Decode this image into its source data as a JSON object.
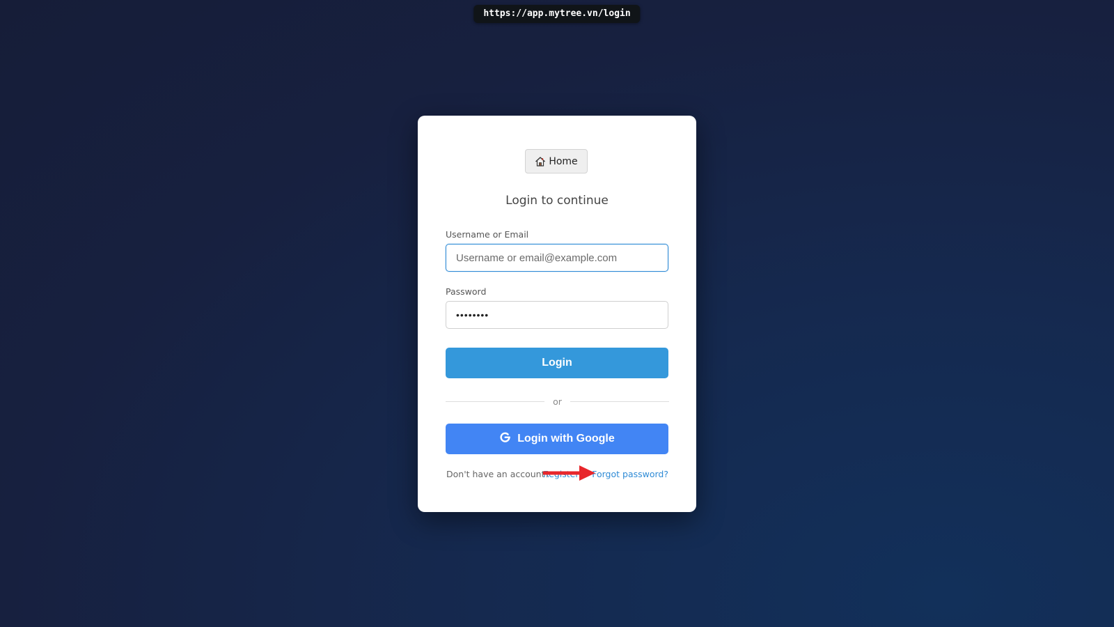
{
  "browser": {
    "url": "https://app.mytree.vn/login"
  },
  "home_button": {
    "label": "Home",
    "icon": "home-icon"
  },
  "form": {
    "title": "Login to continue",
    "username": {
      "label": "Username or Email",
      "placeholder": "Username or email@example.com",
      "value": ""
    },
    "password": {
      "label": "Password",
      "value": "••••••••"
    },
    "login_button": "Login",
    "divider_text": "or",
    "google_button": {
      "label": "Login with Google",
      "icon": "google-g-icon"
    }
  },
  "footer": {
    "no_account_text": "Don't have an account?",
    "register_label": "Register",
    "forgot_label": "Forgot password?"
  },
  "annotation": {
    "arrow_color": "#e8262b",
    "icon": "red-arrow-icon"
  },
  "colors": {
    "primary": "#3498db",
    "google": "#4285f4",
    "link": "#2f8bd6"
  }
}
